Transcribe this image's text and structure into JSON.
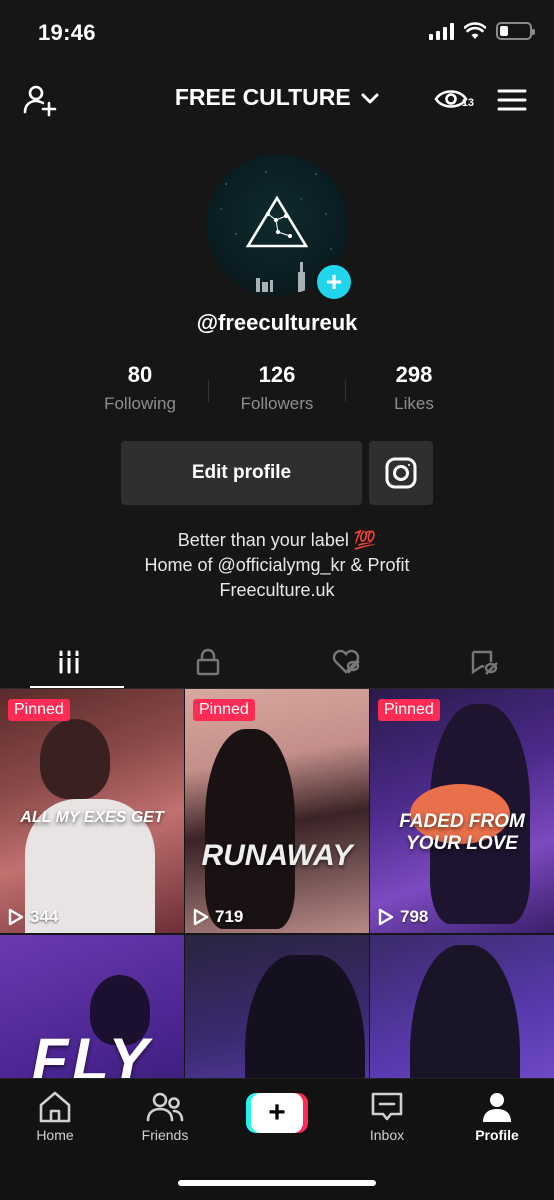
{
  "status": {
    "time": "19:46",
    "battery_level": 0.3
  },
  "header": {
    "account_name": "FREE CULTURE",
    "profile_views": "13"
  },
  "profile": {
    "username": "@freecultureuk",
    "stats": [
      {
        "value": "80",
        "label": "Following"
      },
      {
        "value": "126",
        "label": "Followers"
      },
      {
        "value": "298",
        "label": "Likes"
      }
    ],
    "edit_label": "Edit profile",
    "bio": [
      "Better than your label 💯",
      "Home of @officialymg_kr & Profit",
      "Freeculture.uk"
    ]
  },
  "tabs": [
    {
      "name": "videos-icon",
      "active": true
    },
    {
      "name": "private-icon",
      "active": false
    },
    {
      "name": "liked-icon",
      "active": false
    },
    {
      "name": "favorites-icon",
      "active": false
    }
  ],
  "videos": [
    {
      "pinned": "Pinned",
      "overlay": "ALL MY EXES GET",
      "plays": "344"
    },
    {
      "pinned": "Pinned",
      "overlay": "RUNAWAY",
      "plays": "719"
    },
    {
      "pinned": "Pinned",
      "overlay": "FADED FROM\nYOUR LOVE",
      "plays": "798"
    },
    {
      "pinned": "",
      "overlay": "FLY",
      "plays": ""
    },
    {
      "pinned": "",
      "overlay": "",
      "plays": ""
    },
    {
      "pinned": "",
      "overlay": "",
      "plays": ""
    }
  ],
  "bottom_nav": [
    {
      "label": "Home"
    },
    {
      "label": "Friends"
    },
    {
      "label": "Inbox"
    },
    {
      "label": "Profile"
    }
  ],
  "colors": {
    "accent": "#fe2c55",
    "cyan": "#20d5ec",
    "background": "#161616"
  }
}
